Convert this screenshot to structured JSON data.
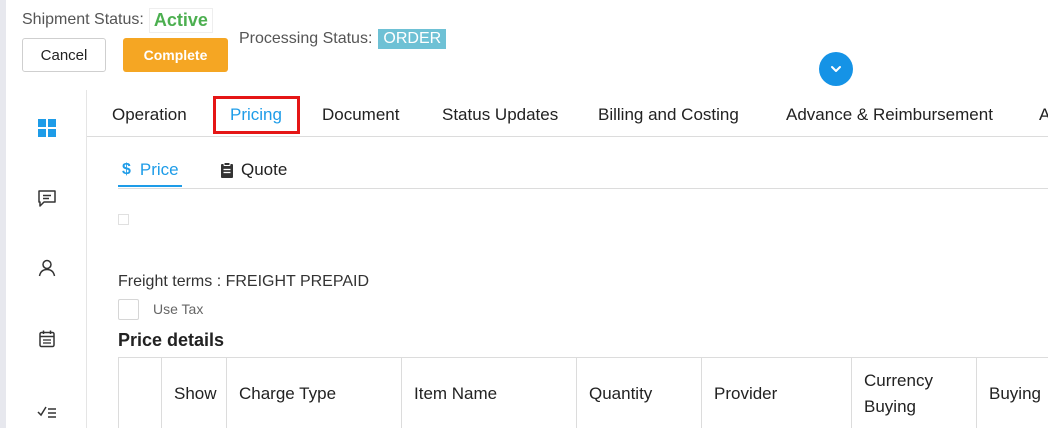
{
  "header": {
    "shipment_status_label": "Shipment Status:",
    "shipment_status_value": "Active",
    "processing_status_label": "Processing Status:",
    "processing_status_value": "ORDER",
    "cancel_label": "Cancel",
    "complete_label": "Complete"
  },
  "sidebar": {
    "items": [
      "dashboard-icon",
      "message-icon",
      "user-icon",
      "calendar-icon",
      "checklist-icon"
    ]
  },
  "tabs": [
    {
      "label": "Operation"
    },
    {
      "label": "Pricing"
    },
    {
      "label": "Document"
    },
    {
      "label": "Status Updates"
    },
    {
      "label": "Billing and Costing"
    },
    {
      "label": "Advance & Reimbursement"
    },
    {
      "label": "A"
    }
  ],
  "subtabs": [
    {
      "label": "Price",
      "icon": "$"
    },
    {
      "label": "Quote",
      "icon": "clipboard-icon"
    }
  ],
  "freight_terms": "Freight terms : FREIGHT PREPAID",
  "use_tax_label": "Use Tax",
  "price_details_title": "Price details",
  "table": {
    "headers": [
      "Show",
      "Charge Type",
      "Item Name",
      "Quantity",
      "Provider",
      "Currency Buying",
      "Buying"
    ],
    "currency_line1": "Currency",
    "currency_line2": "Buying"
  },
  "colors": {
    "accent": "#1e9ce8",
    "active_status": "#4caf50",
    "complete_button": "#f5a623",
    "order_badge": "#6ec1d5",
    "highlight": "#e51616"
  }
}
